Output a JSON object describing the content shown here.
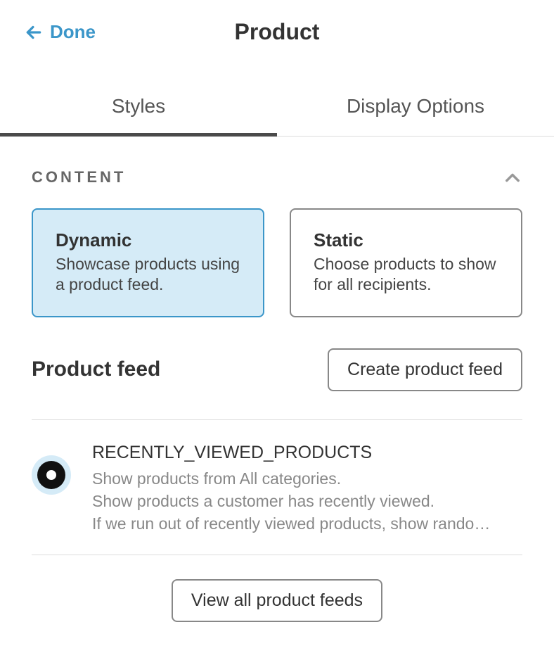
{
  "header": {
    "back_label": "Done",
    "title": "Product"
  },
  "tabs": {
    "styles": "Styles",
    "display_options": "Display Options"
  },
  "section": {
    "title": "CONTENT"
  },
  "cards": {
    "dynamic": {
      "title": "Dynamic",
      "desc": "Showcase products using a product feed."
    },
    "static": {
      "title": "Static",
      "desc": "Choose products to show for all recipients."
    }
  },
  "product_feed": {
    "title": "Product feed",
    "create_label": "Create product feed",
    "selected": {
      "name": "RECENTLY_VIEWED_PRODUCTS",
      "line1": "Show products from All categories.",
      "line2": "Show products a customer has recently viewed.",
      "line3": "If we run out of recently viewed products, show rando…"
    },
    "view_all_label": "View all product feeds"
  }
}
